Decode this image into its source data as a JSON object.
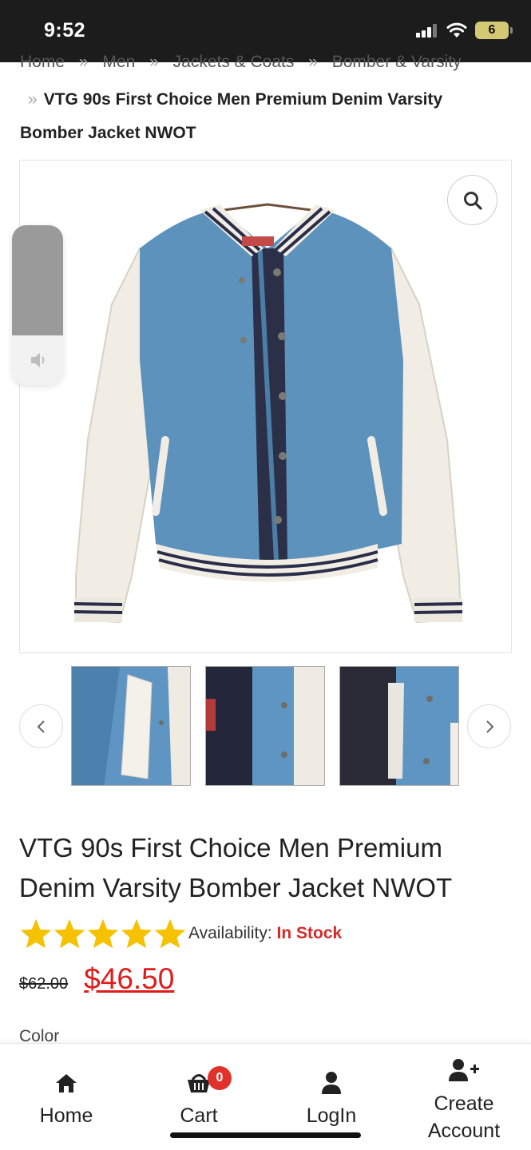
{
  "status_bar": {
    "time": "9:52",
    "battery": "6"
  },
  "breadcrumb": {
    "items": [
      "Home",
      "Men",
      "Jackets & Coats",
      "Bomber & Varsity"
    ],
    "separator": "»",
    "current": "VTG 90s First Choice Men Premium Denim Varsity Bomber Jacket NWOT"
  },
  "product": {
    "title": "VTG 90s First Choice Men Premium Denim Varsity Bomber Jacket NWOT",
    "rating": 5,
    "rating_max": 5,
    "availability_label": "Availability:",
    "availability_value": "In Stock",
    "old_price": "$62.00",
    "price": "$46.50",
    "color_label": "Color"
  },
  "gallery": {
    "zoom_icon": "search-icon",
    "prev_icon": "chevron-left-icon",
    "next_icon": "chevron-right-icon",
    "thumbnail_count": 3
  },
  "volume_hud": {
    "level": 0.69,
    "icon": "speaker-icon"
  },
  "bottom_nav": {
    "home": "Home",
    "cart": "Cart",
    "cart_count": "0",
    "login": "LogIn",
    "create_line1": "Create",
    "create_line2": "Account"
  },
  "colors": {
    "accent_red": "#e01b1b",
    "stock_red": "#d42a2a",
    "star_yellow": "#f6c200",
    "status_bar": "#1c1c1c",
    "denim": "#5b8fb9"
  }
}
